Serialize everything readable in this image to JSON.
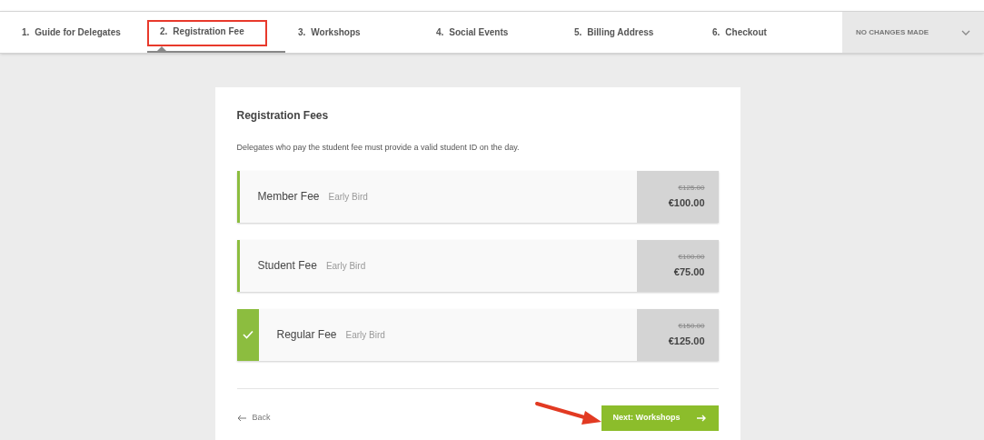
{
  "steps": [
    {
      "number": "1.",
      "label": "Guide for Delegates",
      "selected": false,
      "highlighted": false
    },
    {
      "number": "2.",
      "label": "Registration Fee",
      "selected": true,
      "highlighted": true
    },
    {
      "number": "3.",
      "label": "Workshops",
      "selected": false,
      "highlighted": false
    },
    {
      "number": "4.",
      "label": "Social Events",
      "selected": false,
      "highlighted": false
    },
    {
      "number": "5.",
      "label": "Billing Address",
      "selected": false,
      "highlighted": false
    },
    {
      "number": "6.",
      "label": "Checkout",
      "selected": false,
      "highlighted": false
    }
  ],
  "changes_dropdown": {
    "label": "NO CHANGES MADE"
  },
  "card": {
    "title": "Registration Fees",
    "note": "Delegates who pay the student fee must provide a valid student ID on the day.",
    "fees": [
      {
        "name": "Member Fee",
        "tag": "Early Bird",
        "old_price": "€125.00",
        "price": "€100.00",
        "selected": false
      },
      {
        "name": "Student Fee",
        "tag": "Early Bird",
        "old_price": "€100.00",
        "price": "€75.00",
        "selected": false
      },
      {
        "name": "Regular Fee",
        "tag": "Early Bird",
        "old_price": "€150.00",
        "price": "€125.00",
        "selected": true
      }
    ],
    "back": "Back",
    "next": "Next: Workshops",
    "next_annotated": true
  }
}
